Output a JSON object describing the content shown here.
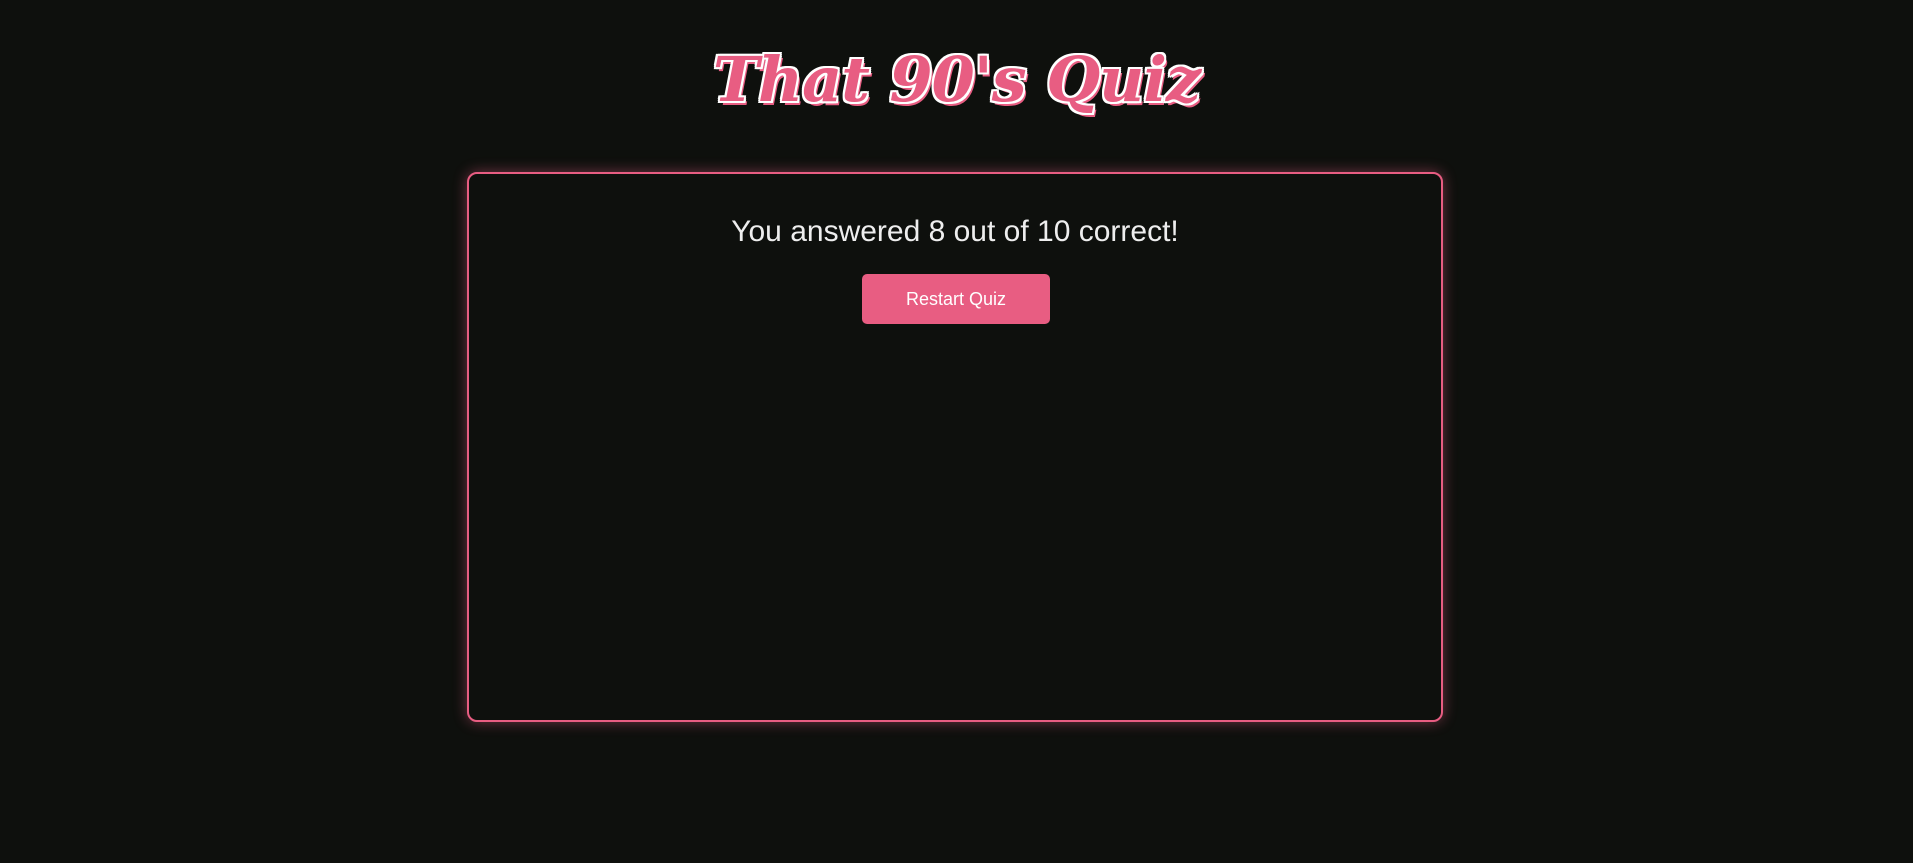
{
  "header": {
    "title": "That 90's Quiz"
  },
  "result": {
    "message": "You answered 8 out of 10 correct!",
    "correct": 8,
    "total": 10
  },
  "actions": {
    "restart_label": "Restart Quiz"
  },
  "colors": {
    "background": "#0e100d",
    "accent": "#e85d82",
    "text": "#eeeeee"
  }
}
